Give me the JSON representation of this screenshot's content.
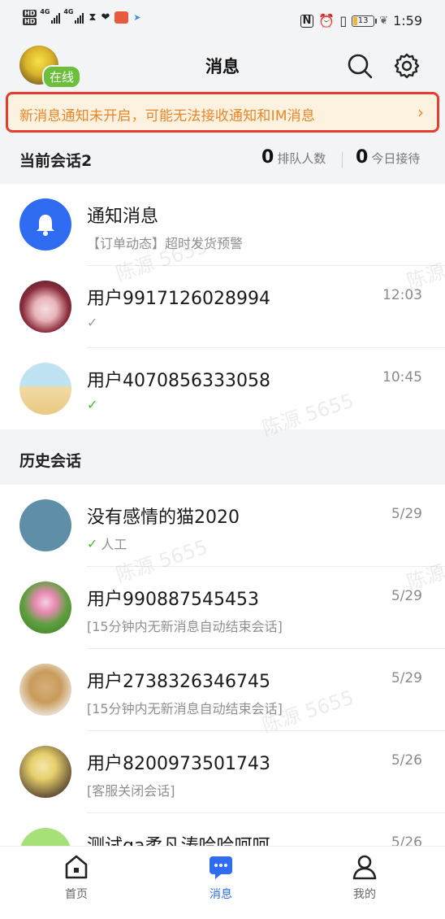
{
  "status_bar": {
    "net_a": "4G",
    "net_b": "4G",
    "battery": "13",
    "time": "1:59",
    "nfc": "N",
    "hd_a": "HD",
    "hd_b": "HD"
  },
  "header": {
    "title": "消息",
    "online_badge": "在线"
  },
  "banner": {
    "text": "新消息通知未开启，可能无法接收通知和IM消息",
    "arrow": "›"
  },
  "current": {
    "title": "当前会话2",
    "queue_count": "0",
    "queue_label": "排队人数",
    "today_count": "0",
    "today_label": "今日接待",
    "items": [
      {
        "name": "通知消息",
        "sub": "【订单动态】超时发货预警",
        "time": "",
        "avatar_icon": "bell-icon"
      },
      {
        "name": "用户9917126028994",
        "sub": "",
        "time": "12:03",
        "check": "✓",
        "check_color": "#999999"
      },
      {
        "name": "用户4070856333058",
        "sub": "",
        "time": "10:45",
        "check": "✓",
        "check_color": "#52b43b"
      }
    ]
  },
  "history": {
    "title": "历史会话",
    "items": [
      {
        "name": "没有感情的猫2020",
        "sub": "人工",
        "time": "5/29",
        "check": "✓"
      },
      {
        "name": "用户990887545453",
        "sub": "[15分钟内无新消息自动结束会话]",
        "time": "5/29"
      },
      {
        "name": "用户2738326346745",
        "sub": "[15分钟内无新消息自动结束会话]",
        "time": "5/29"
      },
      {
        "name": "用户8200973501743",
        "sub": "[客服关闭会话]",
        "time": "5/26"
      },
      {
        "name": "测试qa柔凡涛哈哈呵呵",
        "sub": "",
        "time": "5/26"
      }
    ]
  },
  "tabbar": {
    "home": "首页",
    "messages": "消息",
    "me": "我的"
  },
  "watermark": {
    "text": "陈源 5655",
    "partial": "陈源"
  },
  "colors": {
    "accent_blue": "#2f6cf2",
    "banner_text": "#e6882a",
    "banner_border": "#e43e2f",
    "online_green": "#6cbf3c",
    "check_green": "#52b43b"
  }
}
